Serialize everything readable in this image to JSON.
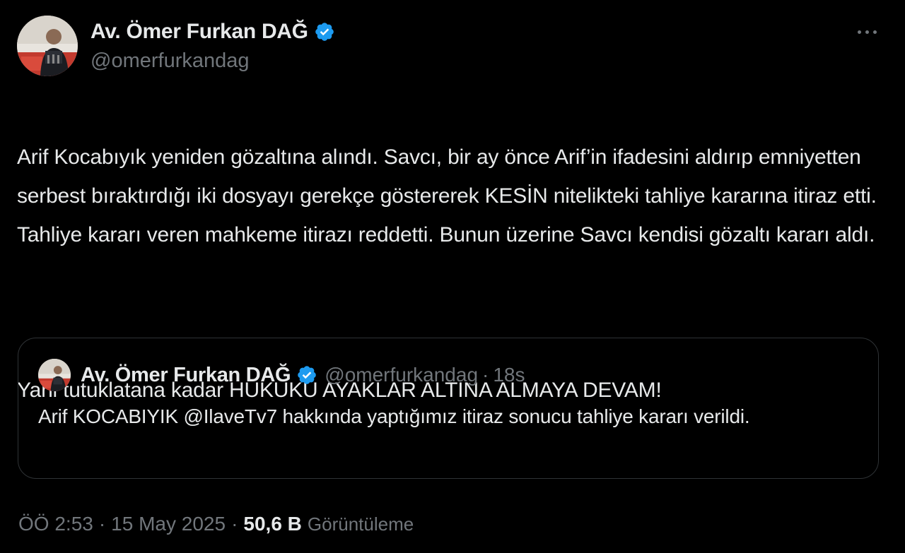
{
  "author": {
    "name": "Av. Ömer Furkan DAĞ",
    "handle": "@omerfurkandag",
    "verified_badge_icon": "verified-badge-icon",
    "verified_color": "#1d9bf0"
  },
  "tweet": {
    "paragraphs": [
      "Arif Kocabıyık yeniden gözaltına alındı. Savcı, bir ay önce Arif’in ifadesini aldırıp emniyetten serbest bıraktırdığı iki dosyayı gerekçe göstererek KESİN nitelikteki tahliye kararına itiraz etti. Tahliye kararı veren mahkeme itirazı reddetti. Bunun üzerine Savcı kendisi gözaltı kararı aldı.",
      "Yani tutuklatana kadar HUKUKU AYAKLAR ALTINA ALMAYA DEVAM!"
    ]
  },
  "quote": {
    "name": "Av. Ömer Furkan DAĞ",
    "handle": "@omerfurkandag",
    "separator": "·",
    "time": "18s",
    "text": "Arif KOCABIYIK @IlaveTv7 hakkında yaptığımız itiraz sonucu tahliye kararı verildi."
  },
  "meta": {
    "time": "ÖÖ 2:53",
    "separator": "·",
    "date": "15 May 2025",
    "views_count": "50,6 B",
    "views_label": "Görüntüleme"
  },
  "more_icon": "more-horizontal-icon",
  "colors": {
    "background": "#000000",
    "text_primary": "#e7e9ea",
    "text_secondary": "#71767b",
    "border": "#2f3336",
    "verified": "#1d9bf0"
  }
}
